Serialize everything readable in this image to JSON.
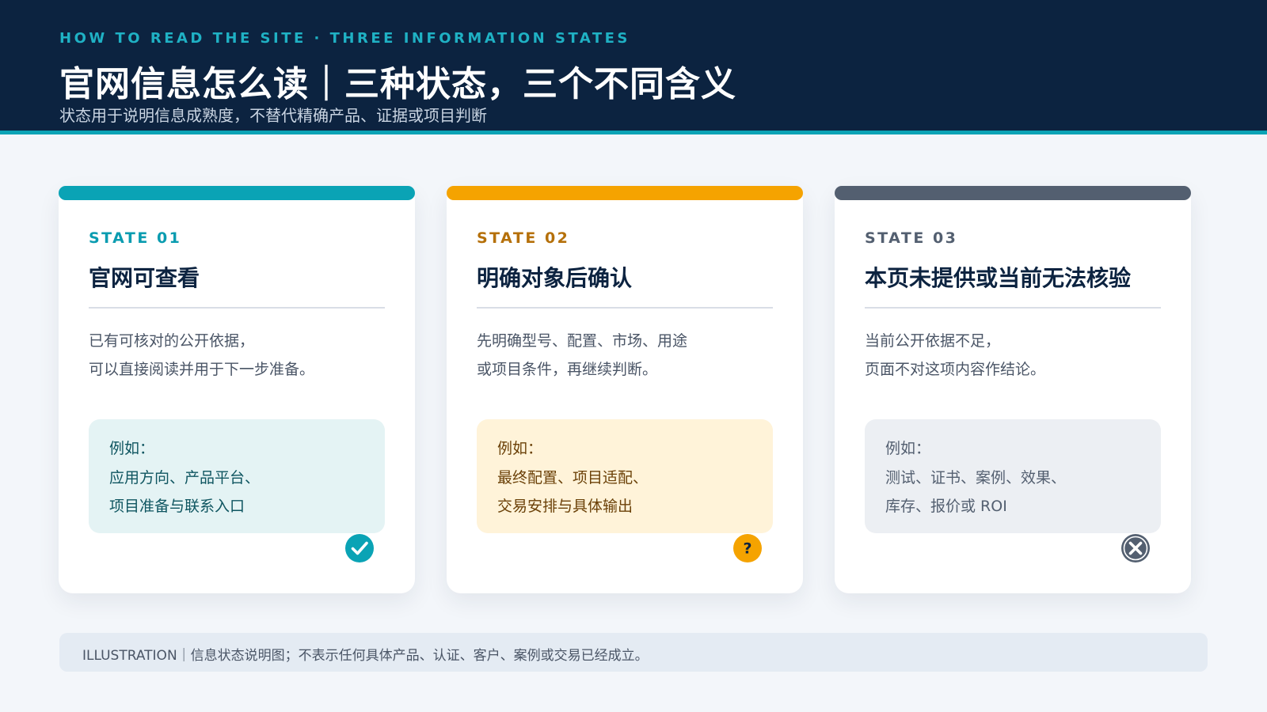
{
  "header": {
    "eyebrow": "HOW TO READ THE SITE · THREE INFORMATION STATES",
    "title": "官网信息怎么读｜三种状态，三个不同含义",
    "subtitle": "状态用于说明信息成熟度，不替代精确产品、证据或项目判断"
  },
  "cards": [
    {
      "state_label": "STATE 01",
      "title": "官网可查看",
      "desc": [
        "已有可核对的公开依据，",
        "可以直接阅读并用于下一步准备。"
      ],
      "example_label": "例如：",
      "example_lines": [
        "应用方向、产品平台、",
        "项目准备与联系入口"
      ],
      "icon": "check-circle-icon",
      "accent": "#0aa3b5",
      "label_color": "#0a9cb0",
      "box_bg": "#e4f3f4",
      "box_text": "#0e5560"
    },
    {
      "state_label": "STATE 02",
      "title": "明确对象后确认",
      "desc": [
        "先明确型号、配置、市场、用途",
        "或项目条件，再继续判断。"
      ],
      "example_label": "例如：",
      "example_lines": [
        "最终配置、项目适配、",
        "交易安排与具体输出"
      ],
      "icon": "question-circle-icon",
      "accent": "#f5a300",
      "label_color": "#b5700a",
      "box_bg": "#fff3d9",
      "box_text": "#6b4108"
    },
    {
      "state_label": "STATE 03",
      "title": "本页未提供或当前无法核验",
      "desc": [
        "当前公开依据不足，",
        "页面不对这项内容作结论。"
      ],
      "example_label": "例如：",
      "example_lines": [
        "测试、证书、案例、效果、",
        "库存、报价或 ROI"
      ],
      "icon": "x-circle-icon",
      "accent": "#535f70",
      "label_color": "#535f70",
      "box_bg": "#eceff3",
      "box_text": "#535f70"
    }
  ],
  "footer": {
    "text": "ILLUSTRATION｜信息状态说明图；不表示任何具体产品、认证、客户、案例或交易已经成立。"
  }
}
